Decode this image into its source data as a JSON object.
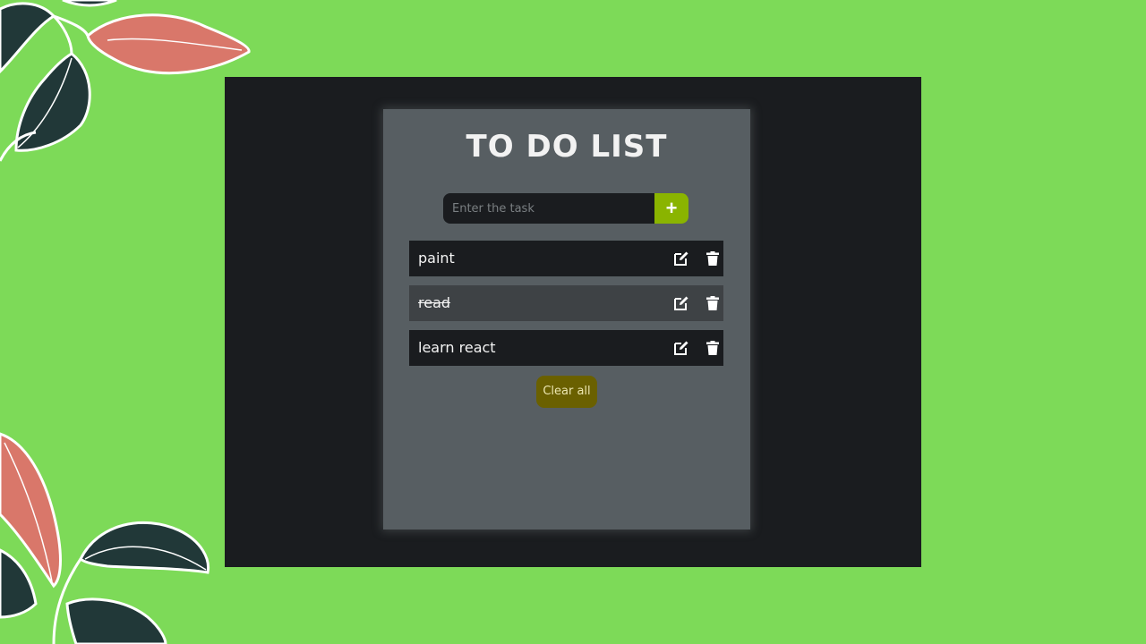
{
  "app": {
    "title": "TO DO LIST",
    "input": {
      "placeholder": "Enter the task",
      "value": ""
    },
    "add_button_label": "+",
    "tasks": [
      {
        "text": "paint",
        "completed": false
      },
      {
        "text": "read",
        "completed": true
      },
      {
        "text": "learn react",
        "completed": false
      }
    ],
    "clear_button_label": "Clear all"
  },
  "icons": {
    "add": "plus-icon",
    "edit": "edit-icon",
    "delete": "trash-icon"
  },
  "colors": {
    "background": "#7dda58",
    "screen": "#1a1c1f",
    "card": "#575e62",
    "add_button": "#8ab400",
    "clear_button": "#6a6000",
    "completed_task": "#3e4245",
    "leaf_red": "#d9776a",
    "leaf_dark": "#213838"
  }
}
